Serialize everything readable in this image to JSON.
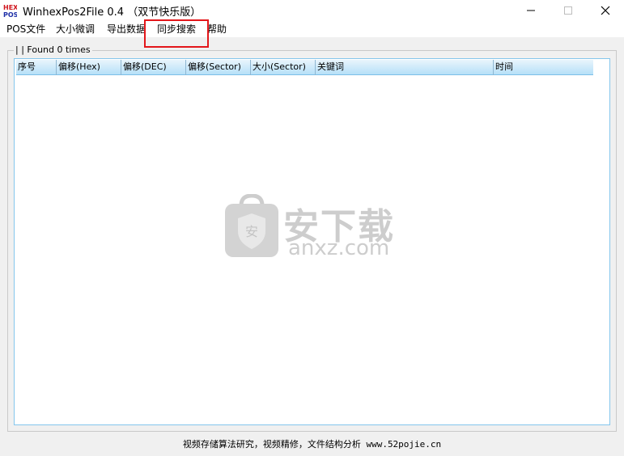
{
  "window": {
    "title": "WinhexPos2File  0.4  （双节快乐版）",
    "icon": "hex-pos-app-icon",
    "controls": {
      "minimize": "minimize-icon",
      "maximize": "maximize-icon",
      "close": "close-icon"
    }
  },
  "menu": {
    "items": [
      {
        "label": "POS文件"
      },
      {
        "label": "大小微调"
      },
      {
        "label": "导出数据"
      },
      {
        "label": "同步搜索"
      },
      {
        "label": "帮助"
      }
    ],
    "highlight_color": "#e3161a"
  },
  "group": {
    "legend": "| | Found 0 times"
  },
  "list": {
    "columns": [
      "序号",
      "偏移(Hex)",
      "偏移(DEC)",
      "偏移(Sector)",
      "大小(Sector)",
      "关键词",
      "时间"
    ],
    "rows": []
  },
  "watermark": {
    "brand": "安下载",
    "url": "anxz.com",
    "color": "#c8c8c8"
  },
  "status": {
    "text": "视频存储算法研究，视频精修，文件结构分析 www.52pojie.cn"
  }
}
